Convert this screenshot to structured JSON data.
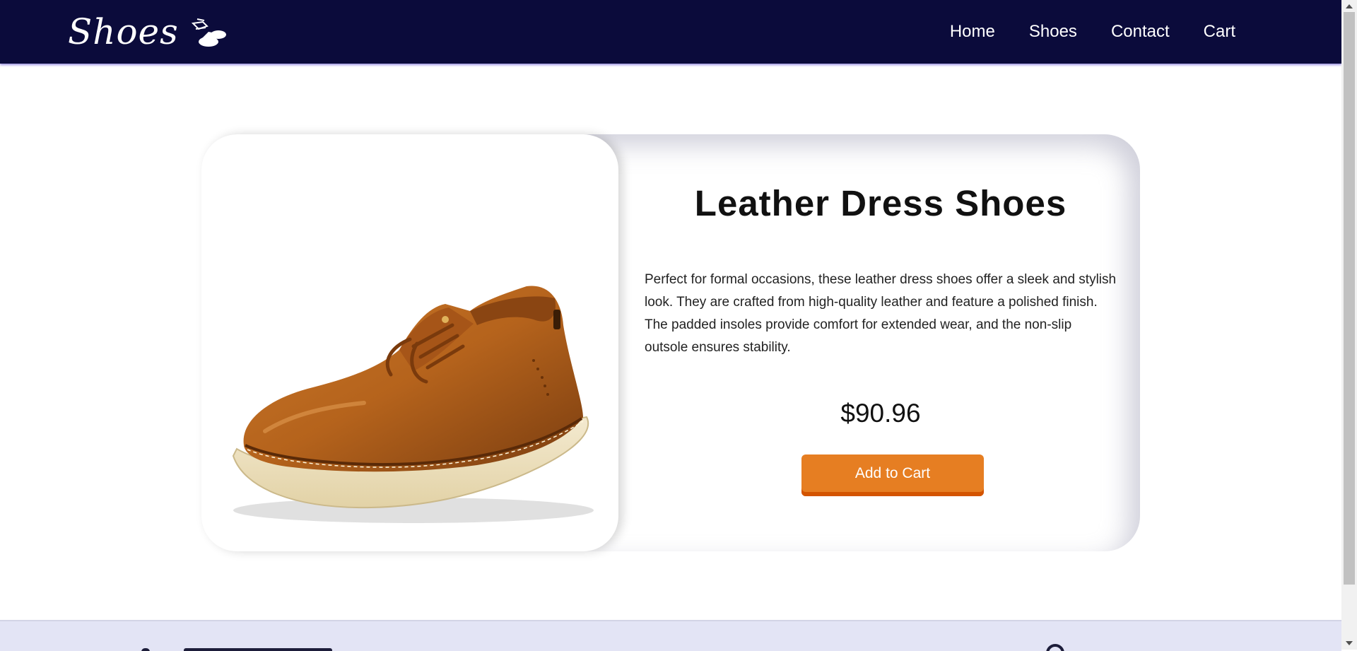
{
  "header": {
    "logo_text": "Shoes",
    "logo_icon": "shoes-icon",
    "nav": [
      {
        "label": "Home"
      },
      {
        "label": "Shoes"
      },
      {
        "label": "Contact"
      },
      {
        "label": "Cart"
      }
    ]
  },
  "product": {
    "title": "Leather Dress Shoes",
    "description": "Perfect for formal occasions, these leather dress shoes offer a sleek and stylish look. They are crafted from high-quality leather and feature a polished finish. The padded insoles provide comfort for extended wear, and the non-slip outsole ensures stability.",
    "price": "$90.96",
    "add_to_cart_label": "Add to Cart",
    "image_icon": "brown-leather-shoe-image"
  },
  "colors": {
    "header_bg": "#0b0b3b",
    "button": "#e67e22",
    "footer_bg": "#e3e4f5"
  }
}
